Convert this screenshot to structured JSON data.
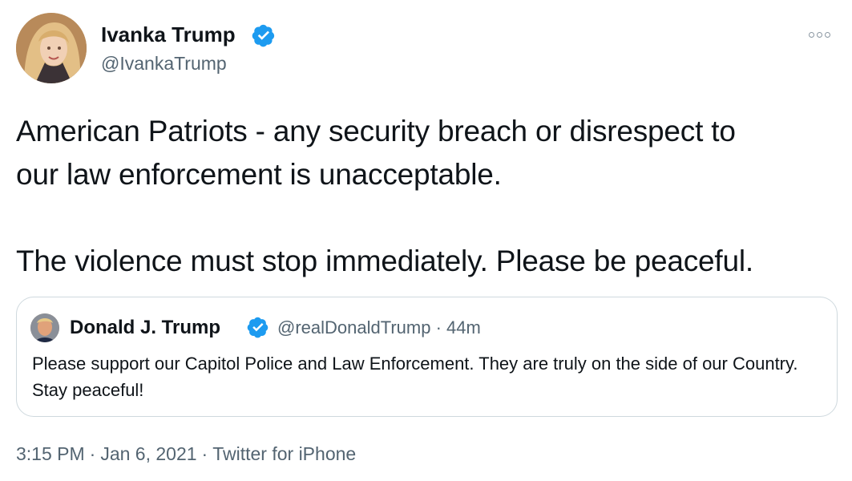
{
  "author": {
    "display_name": "Ivanka Trump",
    "handle": "@IvankaTrump",
    "avatar_icon": "profile-photo",
    "verified_icon": "verified-badge-icon",
    "verified_color": "#1d9bf0"
  },
  "menu": {
    "icon": "more-options-icon"
  },
  "tweet": {
    "line1": "American Patriots - any security breach or disrespect to",
    "line2": "our law enforcement is unacceptable.",
    "line3": "The violence must stop immediately. Please be peaceful."
  },
  "quoted": {
    "display_name": "Donald J. Trump",
    "handle_time": "@realDonaldTrump · 44m",
    "text": "Please support our Capitol Police and Law Enforcement. They are truly on the side of our Country. Stay peaceful!"
  },
  "footer": {
    "time": "3:15 PM",
    "date": "Jan 6, 2021",
    "source": "Twitter for iPhone",
    "separator": "·"
  }
}
